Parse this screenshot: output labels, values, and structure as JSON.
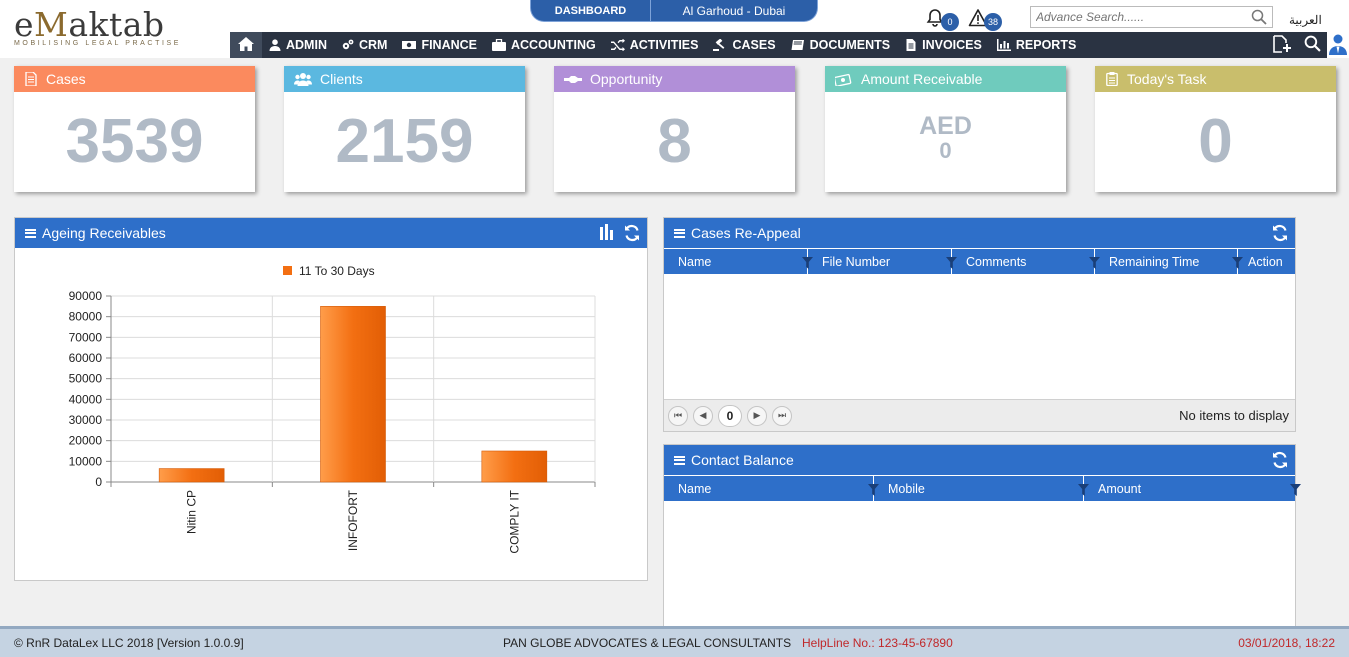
{
  "header": {
    "logo_text": "eMaktab",
    "logo_tagline": "MOBILISING LEGAL PRACTISE",
    "top_tab": "DASHBOARD",
    "branch": "Al Garhoud - Dubai",
    "notifications_count": "0",
    "alerts_count": "38",
    "search_placeholder": "Advance Search......",
    "language_link": "العربية"
  },
  "nav": {
    "items": [
      {
        "label": "ADMIN",
        "icon": "user-icon"
      },
      {
        "label": "CRM",
        "icon": "cogs-icon"
      },
      {
        "label": "FINANCE",
        "icon": "money-icon"
      },
      {
        "label": "ACCOUNTING",
        "icon": "briefcase-icon"
      },
      {
        "label": "ACTIVITIES",
        "icon": "shuffle-icon"
      },
      {
        "label": "CASES",
        "icon": "gavel-icon"
      },
      {
        "label": "DOCUMENTS",
        "icon": "book-icon"
      },
      {
        "label": "INVOICES",
        "icon": "file-icon"
      },
      {
        "label": "REPORTS",
        "icon": "chart-icon"
      }
    ]
  },
  "cards": [
    {
      "title": "Cases",
      "value": "3539",
      "color": "#fb8a5e"
    },
    {
      "title": "Clients",
      "value": "2159",
      "color": "#5bb8e0"
    },
    {
      "title": "Opportunity",
      "value": "8",
      "color": "#b18fd8"
    },
    {
      "title": "Amount Receivable",
      "currency": "AED",
      "value": "0",
      "color": "#6fcbbd"
    },
    {
      "title": "Today's Task",
      "value": "0",
      "color": "#c9be6c"
    }
  ],
  "ageing": {
    "title": "Ageing Receivables"
  },
  "chart_data": {
    "type": "bar",
    "categories": [
      "Nitin CP",
      "INFOFORT",
      "COMPLY IT"
    ],
    "series": [
      {
        "name": "11 To 30 Days",
        "values": [
          6500,
          85000,
          15000
        ],
        "color": "#f36f12"
      }
    ],
    "ylim": [
      0,
      90000
    ],
    "yticks": [
      0,
      10000,
      20000,
      30000,
      40000,
      50000,
      60000,
      70000,
      80000,
      90000
    ],
    "legend_position": "top",
    "grid": true
  },
  "reappeal": {
    "title": "Cases Re-Appeal",
    "columns": [
      "Name",
      "File Number",
      "Comments",
      "Remaining Time",
      "Action"
    ],
    "page": "0",
    "empty_text": "No items to display"
  },
  "contact_balance": {
    "title": "Contact Balance",
    "columns": [
      "Name",
      "Mobile",
      "Amount"
    ]
  },
  "footer": {
    "copyright": "© RnR DataLex LLC 2018 [Version 1.0.0.9]",
    "firm": "PAN GLOBE ADVOCATES & LEGAL CONSULTANTS",
    "helpline": "HelpLine No.: 123-45-67890",
    "datetime": "03/01/2018, 18:22"
  }
}
